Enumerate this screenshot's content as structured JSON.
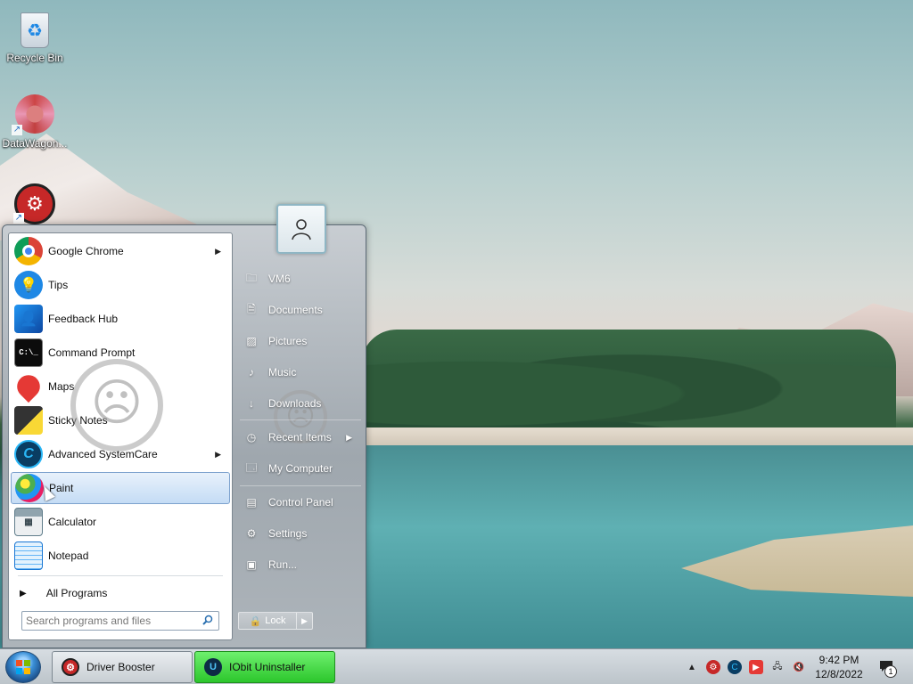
{
  "desktop": {
    "icons": [
      {
        "label": "Recycle Bin",
        "icon": "recycle-bin-icon"
      },
      {
        "label": "DataWagon...",
        "icon": "datawagon-icon"
      },
      {
        "label": "",
        "icon": "driver-booster-icon"
      }
    ]
  },
  "start_menu": {
    "programs": [
      {
        "label": "Google Chrome",
        "icon": "chrome-icon",
        "has_submenu": true
      },
      {
        "label": "Tips",
        "icon": "tips-icon",
        "has_submenu": false
      },
      {
        "label": "Feedback Hub",
        "icon": "feedback-hub-icon",
        "has_submenu": false
      },
      {
        "label": "Command Prompt",
        "icon": "command-prompt-icon",
        "has_submenu": false
      },
      {
        "label": "Maps",
        "icon": "maps-icon",
        "has_submenu": false
      },
      {
        "label": "Sticky Notes",
        "icon": "sticky-notes-icon",
        "has_submenu": false
      },
      {
        "label": "Advanced SystemCare",
        "icon": "advanced-systemcare-icon",
        "has_submenu": true
      },
      {
        "label": "Paint",
        "icon": "paint-icon",
        "has_submenu": false,
        "selected": true
      },
      {
        "label": "Calculator",
        "icon": "calculator-icon",
        "has_submenu": false
      },
      {
        "label": "Notepad",
        "icon": "notepad-icon",
        "has_submenu": false
      }
    ],
    "all_programs": "All Programs",
    "search_placeholder": "Search programs and files",
    "right_items": [
      {
        "label": "VM6",
        "icon": "user-folder-icon"
      },
      {
        "label": "Documents",
        "icon": "documents-icon"
      },
      {
        "label": "Pictures",
        "icon": "pictures-icon"
      },
      {
        "label": "Music",
        "icon": "music-icon"
      },
      {
        "label": "Downloads",
        "icon": "downloads-icon"
      },
      {
        "label": "Recent Items",
        "icon": "recent-items-icon",
        "has_submenu": true
      },
      {
        "label": "My Computer",
        "icon": "computer-icon"
      },
      {
        "label": "Control Panel",
        "icon": "control-panel-icon"
      },
      {
        "label": "Settings",
        "icon": "settings-icon"
      },
      {
        "label": "Run...",
        "icon": "run-icon"
      }
    ],
    "lock_label": "Lock"
  },
  "taskbar": {
    "buttons": [
      {
        "label": "Driver Booster",
        "icon": "driver-booster-icon"
      },
      {
        "label": "IObit Uninstaller",
        "icon": "iobit-uninstaller-icon",
        "active": true
      }
    ],
    "clock": {
      "time": "9:42 PM",
      "date": "12/8/2022"
    },
    "notification_count": "1"
  },
  "colors": {
    "active_task": "#2cc62c",
    "selection": "#c4dcf5"
  }
}
